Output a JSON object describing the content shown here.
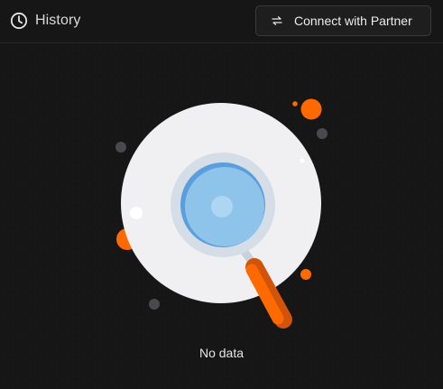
{
  "header": {
    "title": "History",
    "title_icon": "clock-icon",
    "connect_button": {
      "label": "Connect with Partner",
      "icon": "swap-arrows-icon"
    }
  },
  "empty_state": {
    "message": "No data",
    "illustration_icon": "magnifying-glass-icon"
  },
  "colors": {
    "background": "#161616",
    "accent": "#ff6a00",
    "lens": "#8ec4ea",
    "circle": "#f0f0f2"
  }
}
